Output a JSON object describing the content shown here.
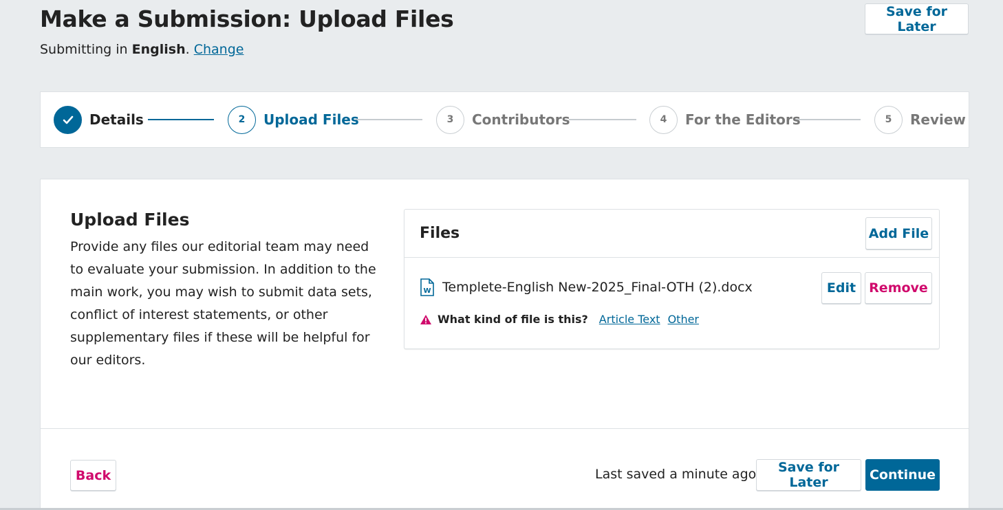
{
  "header": {
    "title": "Make a Submission: Upload Files",
    "submitting_prefix": "Submitting in ",
    "language": "English",
    "period": ".",
    "change_link": "Change",
    "save_for_later": "Save for Later"
  },
  "steps": [
    {
      "number": "",
      "label": "Details",
      "state": "done"
    },
    {
      "number": "2",
      "label": "Upload Files",
      "state": "current"
    },
    {
      "number": "3",
      "label": "Contributors",
      "state": "upcoming"
    },
    {
      "number": "4",
      "label": "For the Editors",
      "state": "upcoming"
    },
    {
      "number": "5",
      "label": "Review",
      "state": "upcoming"
    }
  ],
  "intro": {
    "title": "Upload Files",
    "text": "Provide any files our editorial team may need to evaluate your submission. In addition to the main work, you may wish to submit data sets, conflict of interest statements, or other supplementary files if these will be helpful for our editors."
  },
  "files_panel": {
    "title": "Files",
    "add_file": "Add File",
    "files": [
      {
        "name": "Templete-English New-2025_Final-OTH (2).docx",
        "icon": "word-document-icon",
        "edit": "Edit",
        "remove": "Remove",
        "kind_question": "What kind of file is this?",
        "kind_options": [
          "Article Text",
          "Other"
        ]
      }
    ]
  },
  "footer": {
    "back": "Back",
    "last_saved": "Last saved a minute ago",
    "save_for_later": "Save for Later",
    "continue": "Continue"
  },
  "colors": {
    "primary": "#006798",
    "danger": "#d00a6c",
    "background": "#e9ecee"
  }
}
